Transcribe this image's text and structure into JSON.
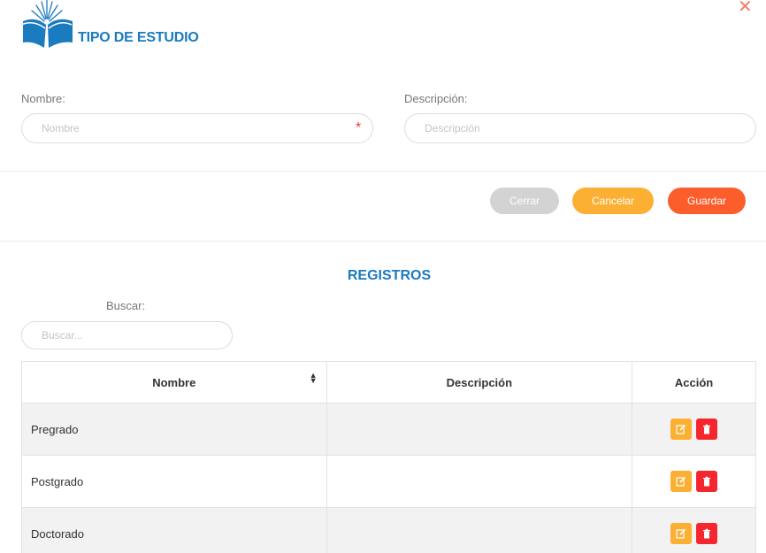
{
  "header": {
    "title": "TIPO DE ESTUDIO",
    "logo_icon": "open-book-sun-icon",
    "close_icon": "close-icon",
    "close_glyph": "✕"
  },
  "form": {
    "nombre": {
      "label": "Nombre:",
      "placeholder": "Nombre",
      "value": "",
      "required_mark": "*"
    },
    "descripcion": {
      "label": "Descripción:",
      "placeholder": "Descripción",
      "value": ""
    }
  },
  "buttons": {
    "cerrar": "Cerrar",
    "cancelar": "Cancelar",
    "guardar": "Guardar"
  },
  "registros": {
    "title": "REGISTROS",
    "search": {
      "label": "Buscar:",
      "placeholder": "Buscar...",
      "value": ""
    },
    "columns": [
      "Nombre",
      "Descripción",
      "Acción"
    ],
    "rows": [
      {
        "nombre": "Pregrado",
        "descripcion": ""
      },
      {
        "nombre": "Postgrado",
        "descripcion": ""
      },
      {
        "nombre": "Doctorado",
        "descripcion": ""
      }
    ]
  },
  "colors": {
    "brand": "#1a7bbf",
    "cerrar": "#d3d3d3",
    "cancelar": "#fbb034",
    "guardar": "#fb5d2b",
    "edit": "#fbb034",
    "delete": "#f4272f"
  }
}
